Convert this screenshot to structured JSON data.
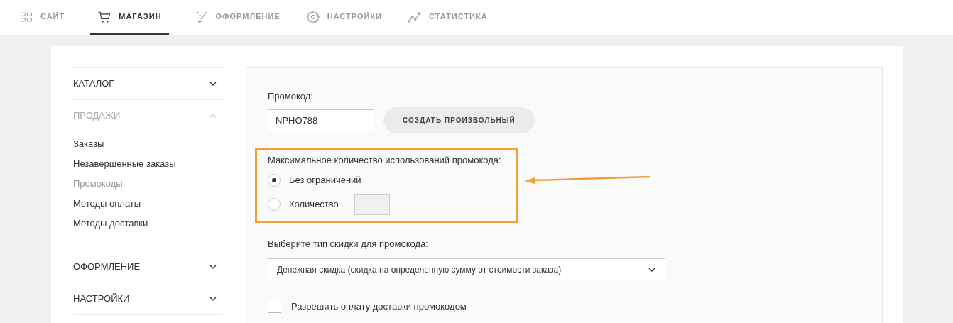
{
  "nav": [
    {
      "label": "САЙТ",
      "selected": false
    },
    {
      "label": "МАГАЗИН",
      "selected": true
    },
    {
      "label": "ОФОРМЛЕНИЕ",
      "selected": false
    },
    {
      "label": "НАСТРОЙКИ",
      "selected": false
    },
    {
      "label": "СТАТИСТИКА",
      "selected": false
    }
  ],
  "sidebar": [
    {
      "label": "КАТАЛОГ",
      "expanded": false
    },
    {
      "label": "ПРОДАЖИ",
      "expanded": true,
      "children": [
        {
          "label": "Заказы",
          "selected": false
        },
        {
          "label": "Незавершенные заказы",
          "selected": false
        },
        {
          "label": "Промокоды",
          "selected": true
        },
        {
          "label": "Методы оплаты",
          "selected": false
        },
        {
          "label": "Методы доставки",
          "selected": false
        }
      ]
    },
    {
      "label": "ОФОРМЛЕНИЕ",
      "expanded": false
    },
    {
      "label": "НАСТРОЙКИ",
      "expanded": false
    }
  ],
  "form": {
    "promo_label": "Промокод:",
    "promo_value": "NPHO788",
    "generate_button": "СОЗДАТЬ ПРОИЗВОЛЬНЫЙ",
    "limit_label": "Максимальное количество использований промокода:",
    "limit_options": [
      {
        "label": "Без ограничений",
        "selected": true,
        "kind": "plain"
      },
      {
        "label": "Количество",
        "selected": false,
        "kind": "count"
      }
    ],
    "discount_label": "Выберите тип скидки для промокода:",
    "discount_value": "Денежная скидка (скидка на определенную сумму от стоимости заказа)",
    "delivery_label": "Разрешить оплату доставки промокодом",
    "delivery_checked": false
  }
}
